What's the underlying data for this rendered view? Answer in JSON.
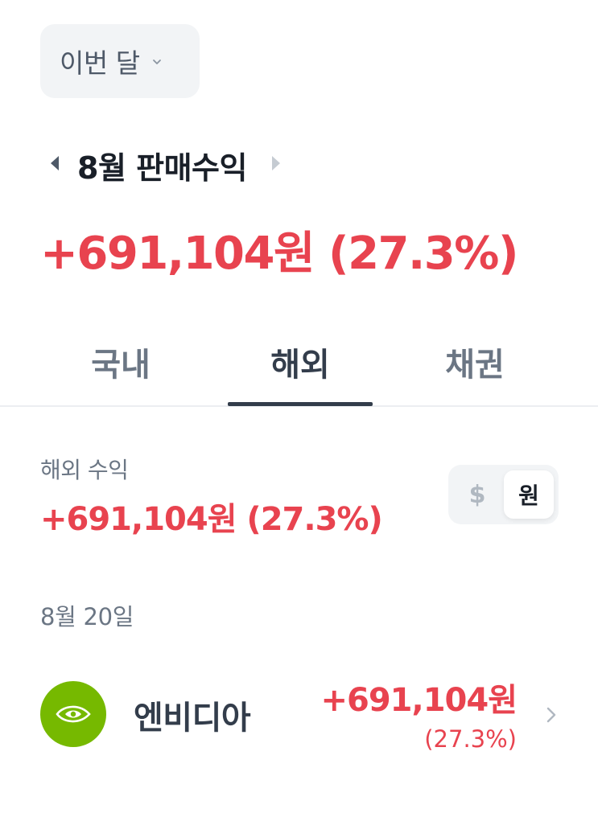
{
  "period": {
    "label": "이번 달",
    "icon": "chevron-down-icon"
  },
  "header": {
    "month_title": "8월 판매수익",
    "total_profit": "+691,104원 (27.3%)"
  },
  "tabs": [
    {
      "label": "국내",
      "active": false
    },
    {
      "label": "해외",
      "active": true
    },
    {
      "label": "채권",
      "active": false
    }
  ],
  "overseas": {
    "label": "해외 수익",
    "profit": "+691,104원 (27.3%)",
    "currency_toggle": {
      "usd": "$",
      "krw": "원",
      "selected": "원"
    }
  },
  "records": {
    "date": "8월 20일",
    "items": [
      {
        "name": "엔비디아",
        "profit": "+691,104원",
        "rate": "(27.3%)",
        "logo_icon": "nvidia-logo-icon",
        "logo_color": "#76b900"
      }
    ]
  },
  "colors": {
    "profit_red": "#e8434f",
    "text_dark": "#191f28",
    "text_gray": "#6b7684",
    "chip_bg": "#f2f4f6"
  }
}
